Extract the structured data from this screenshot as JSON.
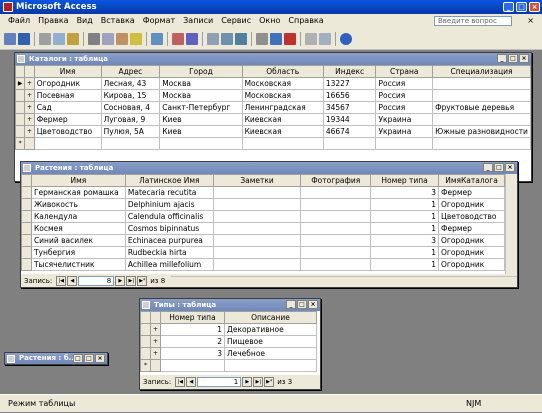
{
  "app": {
    "title": "Microsoft Access"
  },
  "menu": {
    "items": [
      "Файл",
      "Правка",
      "Вид",
      "Вставка",
      "Формат",
      "Записи",
      "Сервис",
      "Окно",
      "Справка"
    ],
    "help_placeholder": "Введите вопрос",
    "close_glyph": "×"
  },
  "windows": {
    "catalogs": {
      "title": "Каталоги : таблица",
      "columns": [
        "Имя",
        "Адрес",
        "Город",
        "Область",
        "Индекс",
        "Страна",
        "Специализация"
      ],
      "rows": [
        [
          "Огородник",
          "Лесная, 43",
          "Москва",
          "Московская",
          "13227",
          "Россия",
          ""
        ],
        [
          "Посевная",
          "Кирова, 15",
          "Москва",
          "Московская",
          "16656",
          "Россия",
          ""
        ],
        [
          "Сад",
          "Сосновая, 4",
          "Санкт-Петербург",
          "Ленинградская",
          "34567",
          "Россия",
          "Фруктовые деревья"
        ],
        [
          "Фермер",
          "Луговая, 9",
          "Киев",
          "Киевская",
          "19344",
          "Украина",
          ""
        ],
        [
          "Цветоводство",
          "Пулюя, 5А",
          "Киев",
          "Киевская",
          "46674",
          "Украина",
          "Южные разновидности"
        ]
      ]
    },
    "plants": {
      "title": "Растения : таблица",
      "columns": [
        "Имя",
        "Латинское Имя",
        "Заметки",
        "Фотография",
        "Номер типа",
        "ИмяКаталога"
      ],
      "rows": [
        [
          "Германская ромашка",
          "Matecaria recutita",
          "",
          "",
          "3",
          "Фермер"
        ],
        [
          "Живокость",
          "Delphinium ajacis",
          "",
          "",
          "1",
          "Огородник"
        ],
        [
          "Календула",
          "Calendula officinalis",
          "",
          "",
          "1",
          "Цветоводство"
        ],
        [
          "Космея",
          "Cosmos bipinnatus",
          "",
          "",
          "1",
          "Фермер"
        ],
        [
          "Синий василек",
          "Echinacea purpurea",
          "",
          "",
          "3",
          "Огородник"
        ],
        [
          "Тунбергия",
          "Rudbeckia hirta",
          "",
          "",
          "1",
          "Огородник"
        ],
        [
          "Тысячелистник",
          "Achillea millefolium",
          "",
          "",
          "1",
          "Огородник"
        ]
      ],
      "nav_label": "Запись:",
      "nav_value": "8",
      "nav_of": "из 8"
    },
    "types": {
      "title": "Типы : таблица",
      "columns": [
        "Номер типа",
        "Описание"
      ],
      "rows": [
        [
          "1",
          "Декоративное"
        ],
        [
          "2",
          "Пищевое"
        ],
        [
          "3",
          "Лечебное"
        ]
      ],
      "nav_label": "Запись:",
      "nav_value": "1",
      "nav_of": "из 3"
    },
    "minimized": {
      "title": "Растения : б..."
    }
  },
  "status": {
    "mode": "Режим таблицы",
    "indicator": "NJM"
  },
  "colors": {
    "titlebar": "#0a55e0",
    "desktop": "#808080",
    "chrome": "#ece9d8"
  }
}
